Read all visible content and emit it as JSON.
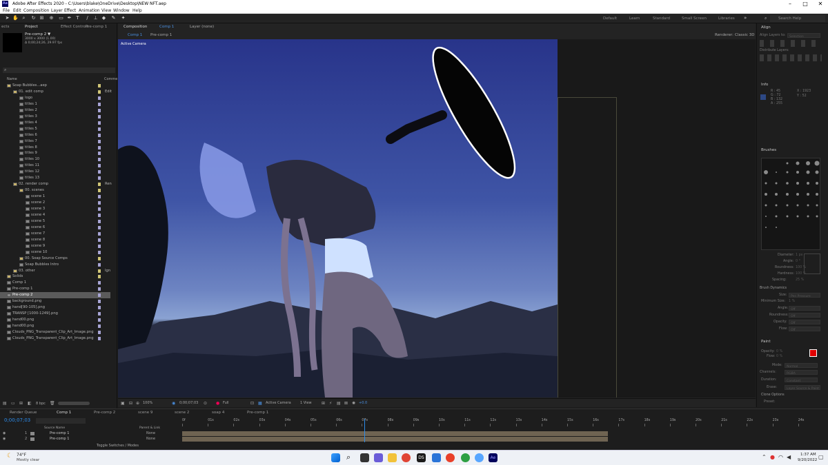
{
  "window": {
    "title": "Adobe After Effects 2020 - C:\\Users\\blake\\OneDrive\\Desktop\\NEW NFT.aep",
    "logo": "Ae",
    "minimize": "–",
    "maximize": "□",
    "close": "✕"
  },
  "menu": [
    "File",
    "Edit",
    "Composition",
    "Layer",
    "Effect",
    "Animation",
    "View",
    "Window",
    "Help"
  ],
  "workspaces": [
    "Default",
    "Learn",
    "Standard",
    "Small Screen",
    "Libraries"
  ],
  "search_placeholder": "Search Help",
  "left": {
    "tabs": [
      "Project",
      "Effect Controls",
      "Pre-comp 1"
    ],
    "tab_left_cut": "ects",
    "selected_item": {
      "name": "Pre-comp 2 ▼",
      "dims": "3000 x 3000 (1.00)",
      "dur": "Δ 0;00;24;26, 29.97 fps"
    },
    "col_name": "Name",
    "col_comment": "Comme",
    "items": [
      {
        "name": "Soap Bubbles...aep",
        "indent": 0,
        "folder": true,
        "note": ""
      },
      {
        "name": "01. edit comp",
        "indent": 1,
        "folder": true,
        "note": "Edit"
      },
      {
        "name": "logo",
        "indent": 2,
        "folder": false,
        "note": ""
      },
      {
        "name": "titles 1",
        "indent": 2,
        "folder": false,
        "note": ""
      },
      {
        "name": "titles 2",
        "indent": 2,
        "folder": false,
        "note": ""
      },
      {
        "name": "titles 3",
        "indent": 2,
        "folder": false,
        "note": ""
      },
      {
        "name": "titles 4",
        "indent": 2,
        "folder": false,
        "note": ""
      },
      {
        "name": "titles 5",
        "indent": 2,
        "folder": false,
        "note": ""
      },
      {
        "name": "titles 6",
        "indent": 2,
        "folder": false,
        "note": ""
      },
      {
        "name": "titles 7",
        "indent": 2,
        "folder": false,
        "note": ""
      },
      {
        "name": "titles 8",
        "indent": 2,
        "folder": false,
        "note": ""
      },
      {
        "name": "titles 9",
        "indent": 2,
        "folder": false,
        "note": ""
      },
      {
        "name": "titles 10",
        "indent": 2,
        "folder": false,
        "note": ""
      },
      {
        "name": "titles 11",
        "indent": 2,
        "folder": false,
        "note": ""
      },
      {
        "name": "titles 12",
        "indent": 2,
        "folder": false,
        "note": ""
      },
      {
        "name": "titles 13",
        "indent": 2,
        "folder": false,
        "note": ""
      },
      {
        "name": "02. render comp",
        "indent": 1,
        "folder": true,
        "note": "Ren"
      },
      {
        "name": "00. scenes",
        "indent": 2,
        "folder": true,
        "note": ""
      },
      {
        "name": "scene 1",
        "indent": 3,
        "folder": false,
        "note": ""
      },
      {
        "name": "scene 2",
        "indent": 3,
        "folder": false,
        "note": ""
      },
      {
        "name": "scene 3",
        "indent": 3,
        "folder": false,
        "note": ""
      },
      {
        "name": "scene 4",
        "indent": 3,
        "folder": false,
        "note": ""
      },
      {
        "name": "scene 5",
        "indent": 3,
        "folder": false,
        "note": ""
      },
      {
        "name": "scene 6",
        "indent": 3,
        "folder": false,
        "note": ""
      },
      {
        "name": "scene 7",
        "indent": 3,
        "folder": false,
        "note": ""
      },
      {
        "name": "scene 8",
        "indent": 3,
        "folder": false,
        "note": ""
      },
      {
        "name": "scene 9",
        "indent": 3,
        "folder": false,
        "note": ""
      },
      {
        "name": "scene 10",
        "indent": 3,
        "folder": false,
        "note": ""
      },
      {
        "name": "00. Soap Source Comps",
        "indent": 2,
        "folder": true,
        "note": ""
      },
      {
        "name": "Soap Bubbles Intro",
        "indent": 2,
        "folder": false,
        "note": ""
      },
      {
        "name": "03. other",
        "indent": 1,
        "folder": true,
        "note": "Ign"
      },
      {
        "name": "Solids",
        "indent": 0,
        "folder": true,
        "note": ""
      },
      {
        "name": "Comp 1",
        "indent": 0,
        "folder": false,
        "note": ""
      },
      {
        "name": "Pre-comp 1",
        "indent": 0,
        "folder": false,
        "note": ""
      },
      {
        "name": "Pre-comp 2",
        "indent": 0,
        "folder": false,
        "note": ""
      },
      {
        "name": "background.png",
        "indent": 0,
        "folder": false,
        "note": ""
      },
      {
        "name": "hand[90-105].png",
        "indent": 0,
        "folder": false,
        "note": ""
      },
      {
        "name": "TRANSP [1000-1249].png",
        "indent": 0,
        "folder": false,
        "note": ""
      },
      {
        "name": "hand00.png",
        "indent": 0,
        "folder": false,
        "note": ""
      },
      {
        "name": "hand00.png",
        "indent": 0,
        "folder": false,
        "note": ""
      },
      {
        "name": "Clouds_PNG_Transparent_Clip_Art_Image.png",
        "indent": 0,
        "folder": false,
        "note": ""
      },
      {
        "name": "Clouds_PNG_Transparent_Clip_Art_Image.png",
        "indent": 0,
        "folder": false,
        "note": ""
      }
    ],
    "bpc": "8 bpc"
  },
  "comp": {
    "tab": "Composition",
    "tab_name": "Comp 1",
    "layer_tab": "Layer (none)",
    "sub_tabs": [
      "Comp 1",
      "Pre-comp 1"
    ],
    "renderer_label": "Renderer:",
    "renderer": "Classic 3D",
    "active_camera": "Active Camera",
    "viewer_bar": {
      "zoom": "100%",
      "time": "0;00;07;03",
      "res": "Full",
      "camera": "Active Camera",
      "views": "1 View",
      "offset": "+0.0"
    }
  },
  "right": {
    "align": {
      "title": "Align",
      "layers_to_label": "Align Layers to:",
      "layers_to": "Selection",
      "distribute": "Distribute Layers:"
    },
    "info": {
      "title": "Info",
      "R": "R : 45",
      "G": "G : 72",
      "B": "B : 132",
      "A": "A : 255",
      "X": "X : 1923",
      "Y": "Y : 52"
    },
    "brushes": {
      "title": "Brushes",
      "rows": [
        "Diameter:",
        "Angle:",
        "Roundness:",
        "Hardness:",
        "Spacing:"
      ],
      "values": [
        "1 px",
        "0 °",
        "100 %",
        "100 %",
        "25 %"
      ],
      "dynamics": "Brush Dynamics",
      "dyn_rows": [
        "Size:",
        "Minimum Size:",
        "Angle:",
        "Roundness:",
        "Opacity:",
        "Flow:"
      ],
      "dyn_values": [
        "Pen Pressure",
        "1 %",
        "Off",
        "Off",
        "Off",
        "Off"
      ]
    },
    "paint": {
      "title": "Paint",
      "opacity": "Opacity:",
      "opacity_val": "0 %",
      "flow": "Flow:",
      "flow_val": "0 %",
      "mode": "Mode:",
      "mode_val": "Normal",
      "channels": "Channels:",
      "channels_val": "RGBA",
      "duration": "Duration:",
      "duration_val": "Constant",
      "erase": "Erase:",
      "erase_val": "Layer Source & Paint",
      "clone": "Clone Options",
      "preset": "Preset:"
    }
  },
  "timeline": {
    "tabs": [
      "Render Queue",
      "Comp 1",
      "Pre-comp 2",
      "scene 9",
      "scene 2",
      "soap 4",
      "Pre-comp 1"
    ],
    "time": "0;00;07;03",
    "cols": [
      "Source Name",
      "Parent & Link"
    ],
    "layers": [
      {
        "num": "1",
        "name": "Pre-comp 1",
        "parent": "None"
      },
      {
        "num": "2",
        "name": "Pre-comp 1",
        "parent": "None"
      }
    ],
    "toggle": "Toggle Switches / Modes",
    "ruler": [
      "0f",
      "01s",
      "02s",
      "03s",
      "04s",
      "05s",
      "06s",
      "07s",
      "08s",
      "09s",
      "10s",
      "11s",
      "12s",
      "13s",
      "14s",
      "15s",
      "16s",
      "17s",
      "18s",
      "19s",
      "20s",
      "21s",
      "22s",
      "23s",
      "24s"
    ],
    "playhead": 7.1,
    "duration": 25
  },
  "taskbar": {
    "weather_temp": "74°F",
    "weather_desc": "Mostly clear",
    "time": "1:37 AM",
    "date": "9/20/2022"
  },
  "colors": {
    "accent": "#2d8ceb",
    "blue_ui": "#4a90e2",
    "label_yellow": "#cfc476",
    "label_lavender": "#a7a4d4",
    "clip_tan": "#6f6452",
    "paint_fg": "#e00000"
  }
}
